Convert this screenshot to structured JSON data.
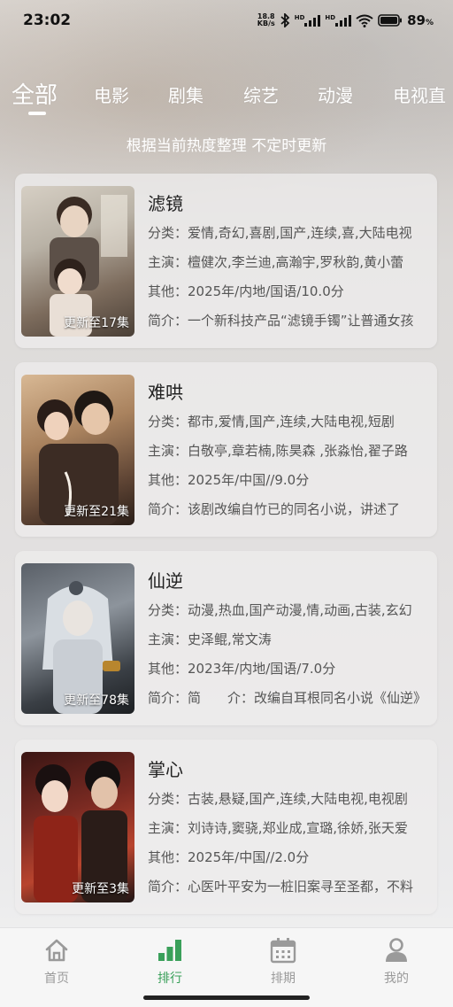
{
  "status_bar": {
    "time": "23:02",
    "net_speed_value": "18.8",
    "net_speed_unit": "KB/s",
    "signal1_label": "HD",
    "signal2_label": "HD",
    "battery": "89",
    "battery_unit": "%"
  },
  "tabs": [
    {
      "label": "全部",
      "active": true
    },
    {
      "label": "电影",
      "active": false
    },
    {
      "label": "剧集",
      "active": false
    },
    {
      "label": "综艺",
      "active": false
    },
    {
      "label": "动漫",
      "active": false
    },
    {
      "label": "电视直",
      "active": false
    }
  ],
  "subtitle": "根据当前热度整理 不定时更新",
  "items": [
    {
      "title": "滤镜",
      "badge": "更新至17集",
      "category": "分类：爱情,奇幻,喜剧,国产,连续,喜,大陆电视",
      "cast": "主演：檀健次,李兰迪,高瀚宇,罗秋韵,黄小蕾",
      "other": "其他：2025年/内地/国语/10.0分",
      "intro": "简介：一个新科技产品“滤镜手镯”让普通女孩",
      "poster_colors": [
        "#b9b2a6",
        "#7d6c5d",
        "#e8ddd2"
      ]
    },
    {
      "title": "难哄",
      "badge": "更新至21集",
      "category": "分类：都市,爱情,国产,连续,大陆电视,短剧",
      "cast": "主演：白敬亭,章若楠,陈昊森 ,张淼怡,翟子路",
      "other": "其他：2025年/中国//9.0分",
      "intro": "简介：该剧改编自竹已的同名小说，讲述了",
      "poster_colors": [
        "#8a6a4e",
        "#c9a27a",
        "#3a2a20"
      ]
    },
    {
      "title": "仙逆",
      "badge": "更新至78集",
      "category": "分类：动漫,热血,国产动漫,情,动画,古装,玄幻",
      "cast": "主演：史泽鲲,常文涛",
      "other": "其他：2023年/内地/国语/7.0分",
      "intro": "简介：简　　介：改编自耳根同名小说《仙逆》",
      "poster_colors": [
        "#4a5058",
        "#c7cdd4",
        "#202428"
      ]
    },
    {
      "title": "掌心",
      "badge": "更新至3集",
      "category": "分类：古装,悬疑,国产,连续,大陆电视,电视剧",
      "cast": "主演：刘诗诗,窦骁,郑业成,宣璐,徐娇,张天爱",
      "other": "其他：2025年/中国//2.0分",
      "intro": "简介：心医叶平安为一桩旧案寻至圣都，不料",
      "poster_colors": [
        "#6e1e1a",
        "#b8442e",
        "#1e1414"
      ]
    }
  ],
  "bottom_nav": [
    {
      "label": "首页",
      "icon": "home-icon",
      "active": false
    },
    {
      "label": "排行",
      "icon": "bar-chart-icon",
      "active": true
    },
    {
      "label": "排期",
      "icon": "calendar-icon",
      "active": false
    },
    {
      "label": "我的",
      "icon": "user-icon",
      "active": false
    }
  ],
  "colors": {
    "accent": "#3aa05a",
    "inactive": "#9a9a9a"
  }
}
